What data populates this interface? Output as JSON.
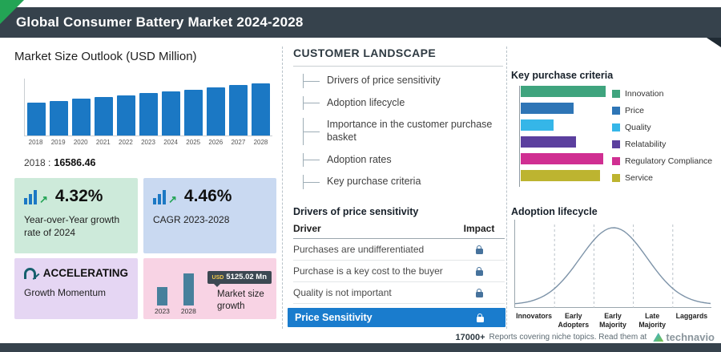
{
  "header": {
    "title": "Global Consumer Battery Market 2024-2028"
  },
  "market_size": {
    "title": "Market Size Outlook (USD Million)",
    "base_label": "2018 :",
    "base_value": "16586.46"
  },
  "stats": {
    "yoy": {
      "value": "4.32%",
      "label": "Year-over-Year growth rate of 2024"
    },
    "cagr": {
      "value": "4.46%",
      "label": "CAGR 2023-2028"
    },
    "momentum": {
      "value": "ACCELERATING",
      "label": "Growth Momentum"
    },
    "growth": {
      "badge_currency": "USD",
      "badge_value": "5125.02 Mn",
      "label": "Market size growth"
    }
  },
  "customer_landscape": {
    "title": "CUSTOMER LANDSCAPE",
    "items": [
      "Drivers of price sensitivity",
      "Adoption lifecycle",
      "Importance in the customer purchase basket",
      "Adoption rates",
      "Key purchase criteria"
    ]
  },
  "price_sensitivity": {
    "title": "Drivers of price sensitivity",
    "columns": {
      "driver": "Driver",
      "impact": "Impact"
    },
    "rows": [
      "Purchases are undifferentiated",
      "Purchase is a key cost to the buyer",
      "Quality is not important"
    ],
    "highlight": "Price Sensitivity"
  },
  "key_purchase": {
    "title": "Key purchase criteria"
  },
  "adoption": {
    "title": "Adoption lifecycle"
  },
  "footer": {
    "count": "17000+",
    "text": "Reports covering niche topics. Read them at",
    "brand": "technavio"
  },
  "colors": {
    "header_bg": "#36424c",
    "accent_green": "#23a455",
    "bar_blue": "#1b78c4",
    "highlight_blue": "#1a7ccd"
  },
  "chart_data": [
    {
      "type": "bar",
      "title": "Market Size Outlook (USD Million)",
      "categories": [
        "2018",
        "2019",
        "2020",
        "2021",
        "2022",
        "2023",
        "2024",
        "2025",
        "2026",
        "2027",
        "2028"
      ],
      "values": [
        16586.46,
        17392,
        18237,
        19123,
        20053,
        21024,
        21932,
        22917,
        23942,
        25013,
        26149
      ],
      "ylabel": "USD Million",
      "ylim": [
        0,
        28000
      ],
      "bar_color": "#1b78c4"
    },
    {
      "type": "bar",
      "title": "Market size growth",
      "categories": [
        "2023",
        "2028"
      ],
      "values": [
        21024,
        26149
      ],
      "annotation": "USD 5125.02 Mn",
      "bar_color": "#47809c"
    },
    {
      "type": "bar",
      "orientation": "horizontal",
      "title": "Key purchase criteria",
      "categories": [
        "Innovation",
        "Price",
        "Quality",
        "Relatability",
        "Regulatory Compliance",
        "Service"
      ],
      "values": [
        100,
        62,
        39,
        65,
        97,
        93
      ],
      "colors": [
        "#3fa47e",
        "#2e75b6",
        "#35b6e8",
        "#5b3f9e",
        "#d02f92",
        "#bdb430"
      ],
      "xlim": [
        0,
        100
      ],
      "legend_position": "right"
    },
    {
      "type": "line",
      "shape": "bell-curve",
      "title": "Adoption lifecycle",
      "categories": [
        "Innovators",
        "Early Adopters",
        "Early Majority",
        "Late Majority",
        "Laggards"
      ]
    }
  ]
}
